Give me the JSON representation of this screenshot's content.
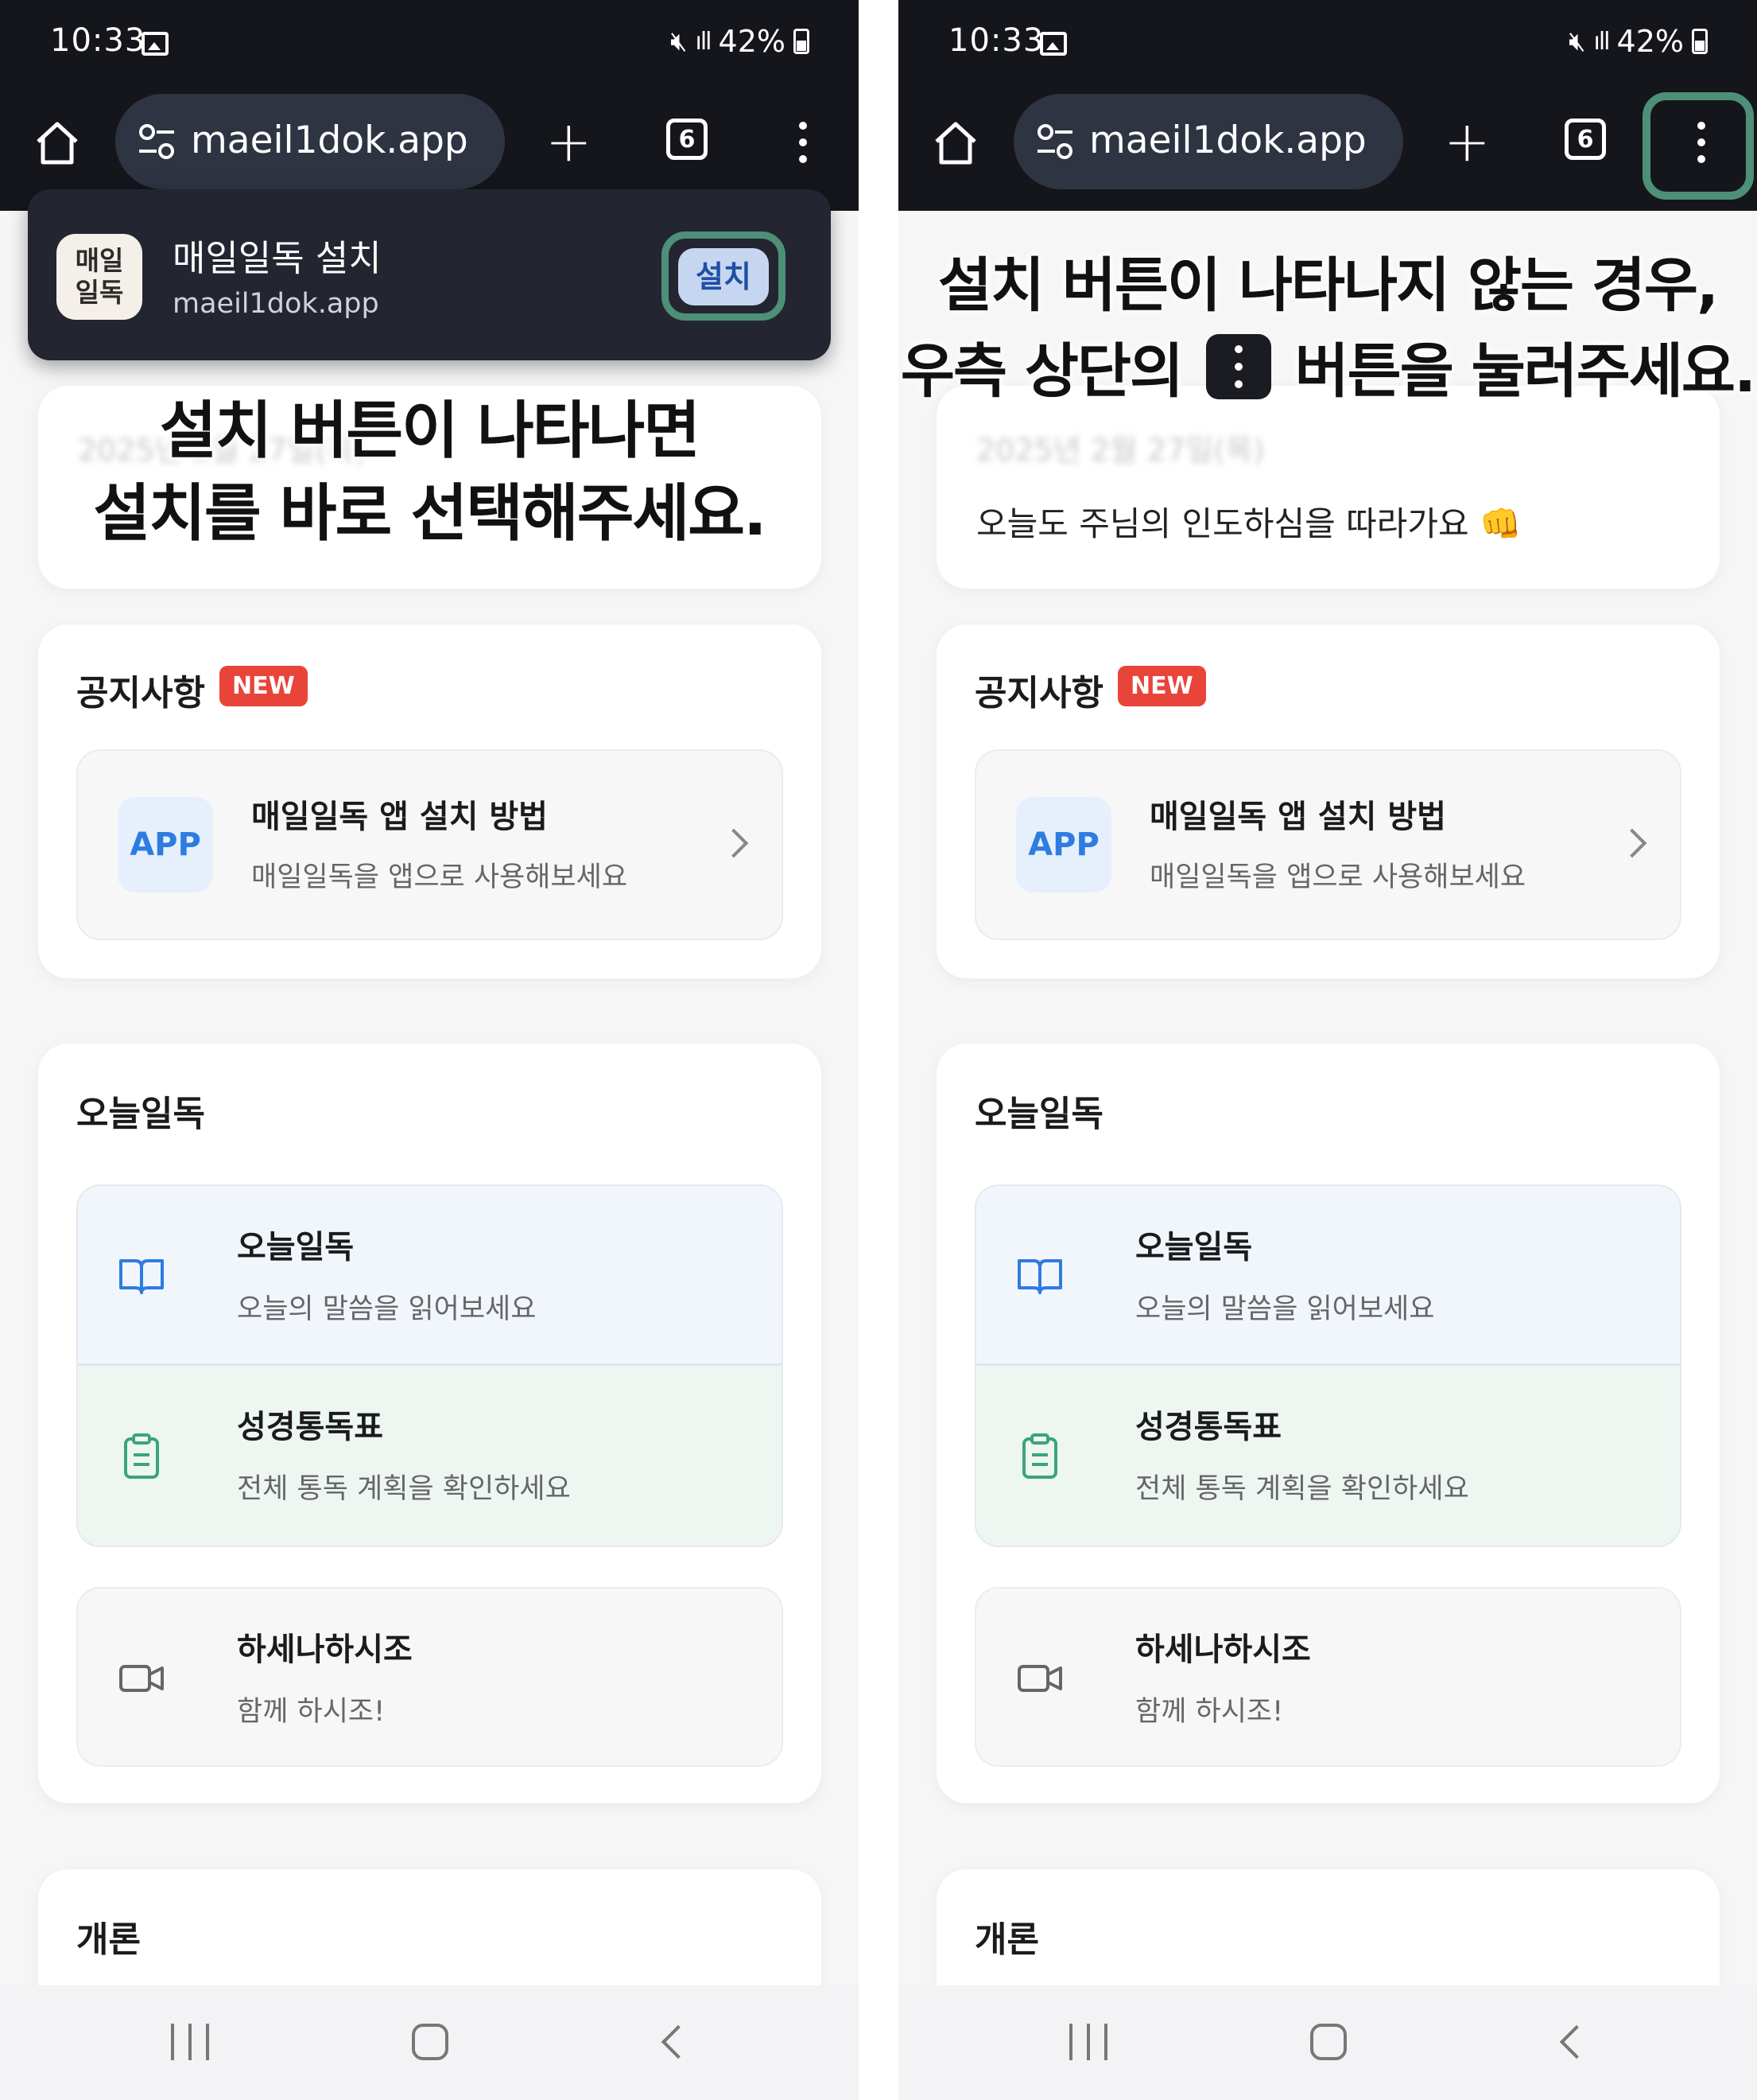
{
  "status_bar": {
    "time": "10:33",
    "battery": "42%",
    "signal": "ıll"
  },
  "browser": {
    "url": "maeil1dok.app",
    "tab_count": "6",
    "plus": "+"
  },
  "install_popup": {
    "app_name": "매일일독 설치",
    "app_url": "maeil1dok.app",
    "icon_line1": "매일",
    "icon_line2": "일독",
    "install_button": "설치"
  },
  "left_overlay": {
    "line1": "설치 버튼이 나타나면",
    "line2": "설치를 바로 선택해주세요."
  },
  "right_overlay": {
    "line1": "설치 버튼이 나타나지 않는 경우,",
    "line2_before": "우측 상단의",
    "line2_after": "버튼을 눌러주세요."
  },
  "header_card": {
    "date_blurred": "2025년 2월 27일(목)",
    "message": "오늘도 주님의 인도하심을 따라가요 👊"
  },
  "notice": {
    "title": "공지사항",
    "badge": "NEW",
    "item_icon": "APP",
    "item_title": "매일일독 앱 설치 방법",
    "item_subtitle": "매일일독을 앱으로 사용해보세요"
  },
  "today": {
    "section_title": "오늘일독",
    "items": [
      {
        "title": "오늘일독",
        "subtitle": "오늘의 말씀을 읽어보세요",
        "icon": "book-icon"
      },
      {
        "title": "성경통독표",
        "subtitle": "전체 통독 계획을 확인하세요",
        "icon": "clipboard-icon"
      },
      {
        "title": "하세나하시조",
        "subtitle": "함께 하시조!",
        "icon": "video-icon"
      }
    ]
  },
  "overview": {
    "section_title": "개론"
  },
  "colors": {
    "highlight_ring": "#4e8f78",
    "badge_red": "#e8443a",
    "app_blue": "#2e7ce0",
    "dark_bar": "#15161b"
  }
}
